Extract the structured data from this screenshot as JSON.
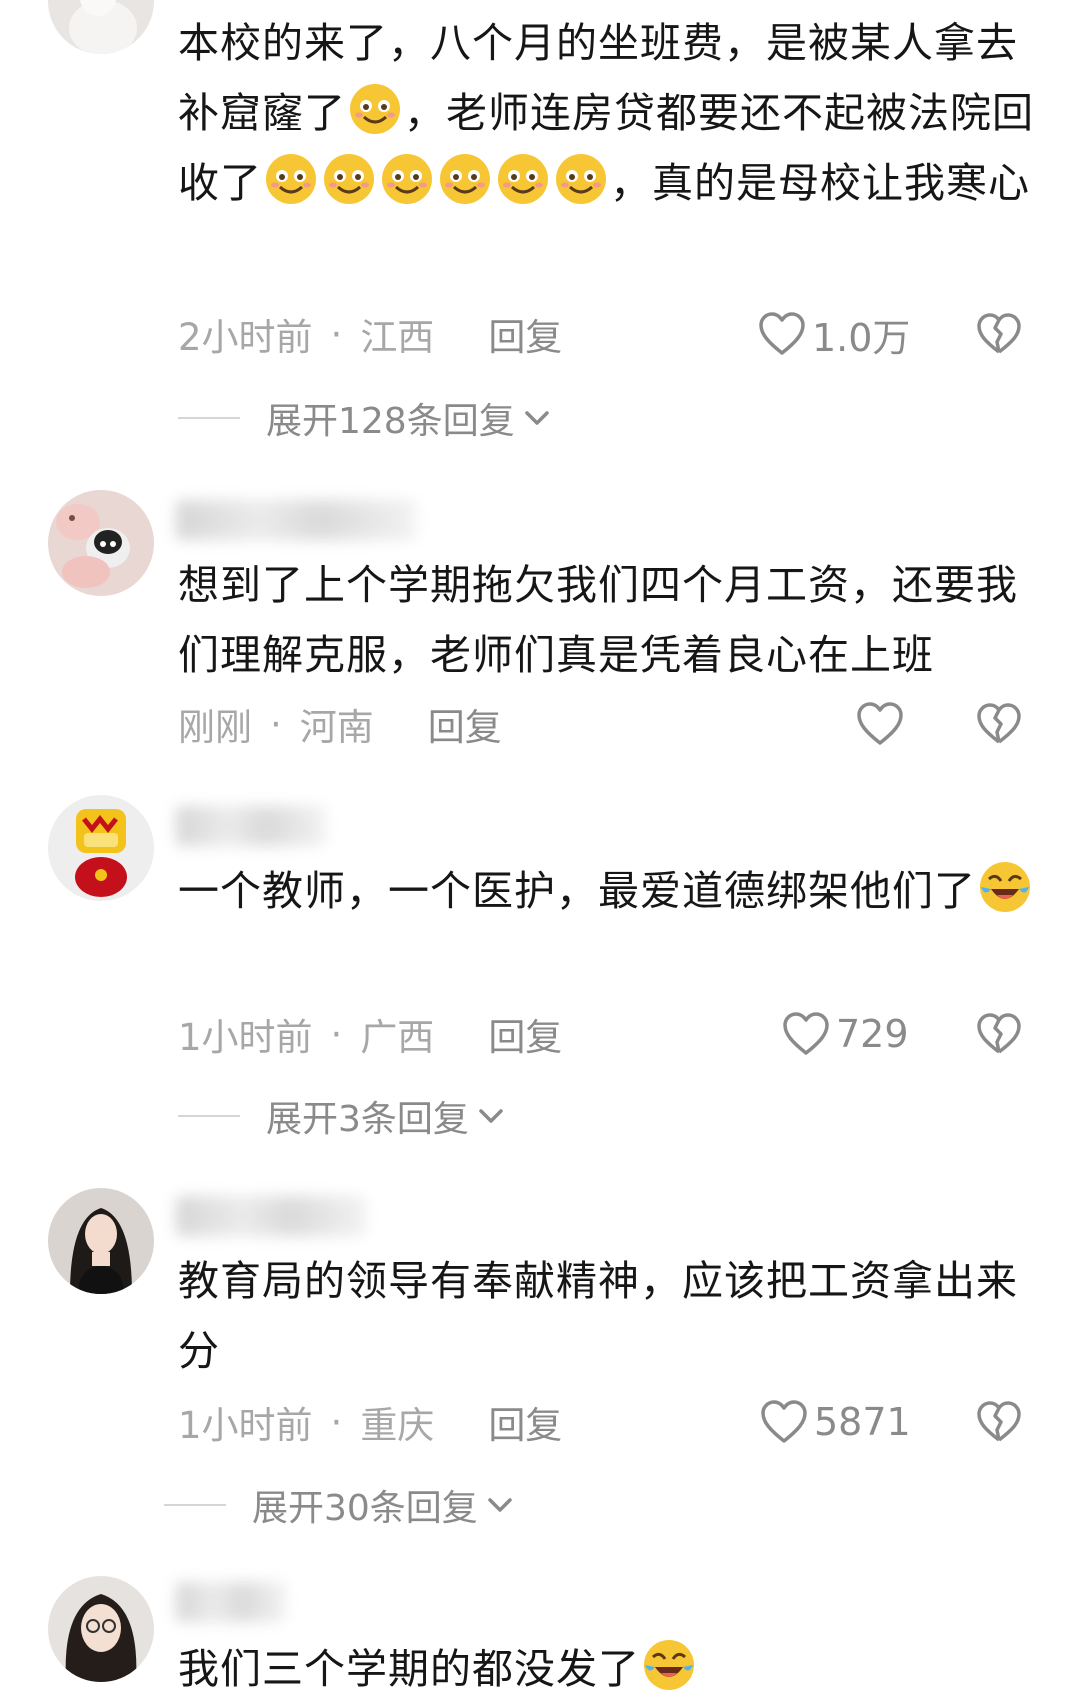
{
  "comments": [
    {
      "text_a": "本校的来了，八个月的坐班费，是被某人拿去补窟窿了",
      "text_b": "，老师连房贷都要还不起被法院回收了",
      "text_c": "，真的是母校让我寒心",
      "time": "2小时前",
      "location": "江西",
      "reply": "回复",
      "likes": "1.0万",
      "expand": "展开128条回复"
    },
    {
      "text": "想到了上个学期拖欠我们四个月工资，还要我们理解克服，老师们真是凭着良心在上班",
      "time": "刚刚",
      "location": "河南",
      "reply": "回复"
    },
    {
      "text": "一个教师，一个医护，最爱道德绑架他们了",
      "time": "1小时前",
      "location": "广西",
      "reply": "回复",
      "likes": "729",
      "expand": "展开3条回复"
    },
    {
      "text": "教育局的领导有奉献精神，应该把工资拿出来分",
      "time": "1小时前",
      "location": "重庆",
      "reply": "回复",
      "likes": "5871",
      "expand": "展开30条回复"
    },
    {
      "text": "我们三个学期的都没发了"
    }
  ],
  "separator": "·",
  "colors": {
    "text": "#161616",
    "meta": "#a7a7a7",
    "action": "#8a8a8a",
    "emoji": "#f7c634"
  },
  "icons": [
    "smile-emoji-icon",
    "laugh-cry-emoji-icon",
    "heart-icon",
    "broken-heart-icon",
    "chevron-down-icon"
  ]
}
